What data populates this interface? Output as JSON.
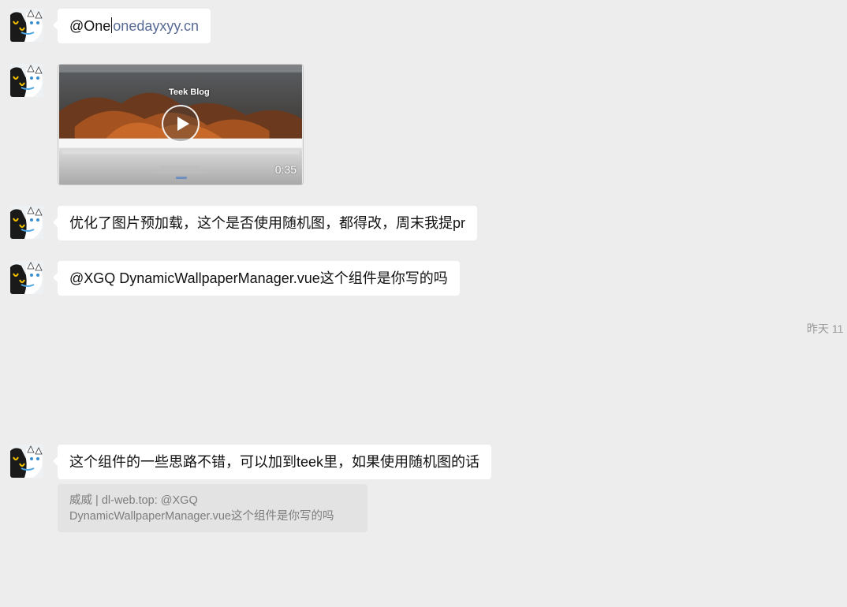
{
  "messages": [
    {
      "prefix": "@One",
      "link": "onedayxyy.cn"
    },
    {
      "video": {
        "title": "Teek Blog",
        "duration": "0:35"
      }
    },
    {
      "text": "优化了图片预加载，这个是否使用随机图，都得改，周末我提pr"
    },
    {
      "text": "@XGQ DynamicWallpaperManager.vue这个组件是你写的吗"
    },
    {
      "text": "这个组件的一些思路不错，可以加到teek里，如果使用随机图的话"
    }
  ],
  "timestamp": "昨天 11",
  "quote": {
    "line1": "威威 | dl-web.top: @XGQ",
    "line2": "DynamicWallpaperManager.vue这个组件是你写的吗"
  },
  "colors": {
    "background": "#ededed",
    "bubble": "#ffffff",
    "link": "#576b95",
    "quote_bg": "#e3e3e3",
    "quote_text": "#7d7d7d",
    "timestamp": "#9a9a9a"
  }
}
